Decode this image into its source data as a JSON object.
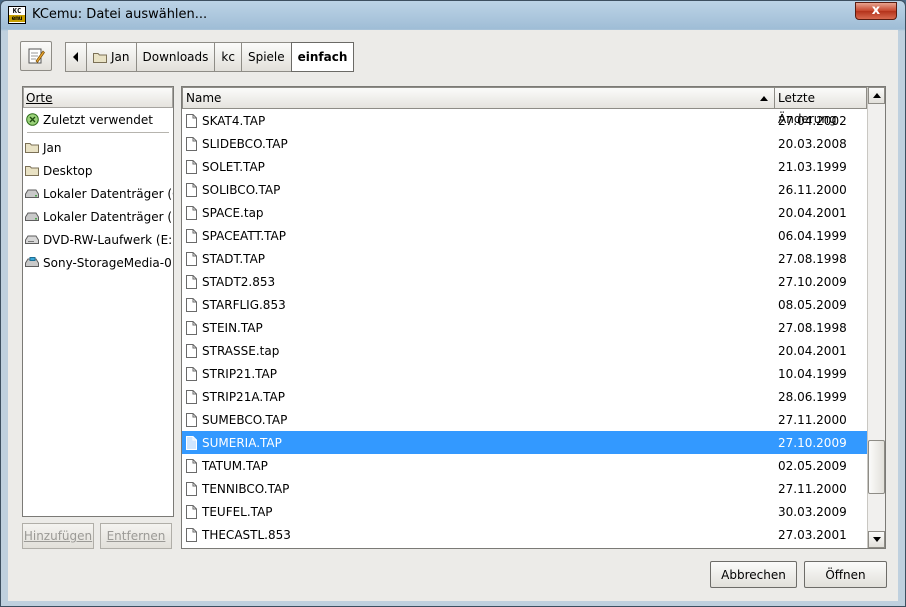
{
  "window": {
    "title": "KCemu: Datei auswählen...",
    "close_label": "x",
    "logo_top": "KC",
    "logo_bottom": "emu"
  },
  "path_bar": {
    "segments": [
      {
        "label": "Jan",
        "icon": "folder-icon"
      },
      {
        "label": "Downloads"
      },
      {
        "label": "kc"
      },
      {
        "label": "Spiele"
      },
      {
        "label": "einfach",
        "active": true
      }
    ]
  },
  "places": {
    "header": "Orte",
    "items": [
      {
        "label": "Zuletzt verwendet",
        "icon": "recent-icon"
      },
      {
        "label": "Jan",
        "icon": "folder-icon"
      },
      {
        "label": "Desktop",
        "icon": "folder-icon"
      },
      {
        "label": "Lokaler Datenträger (C:)",
        "icon": "drive-icon"
      },
      {
        "label": "Lokaler Datenträger (D:)",
        "icon": "drive-icon"
      },
      {
        "label": "DVD-RW-Laufwerk (E:...",
        "icon": "optical-drive-icon"
      },
      {
        "label": "Sony-StorageMedia-0...",
        "icon": "usb-drive-icon"
      }
    ],
    "add_label": "Hinzufügen",
    "remove_label": "Entfernen"
  },
  "files": {
    "columns": {
      "name": "Name",
      "modified": "Letzte Änderung"
    },
    "rows": [
      {
        "name": "SKAT4.TAP",
        "date": "27.04.2002"
      },
      {
        "name": "SLIDEBCO.TAP",
        "date": "20.03.2008"
      },
      {
        "name": "SOLET.TAP",
        "date": "21.03.1999"
      },
      {
        "name": "SOLIBCO.TAP",
        "date": "26.11.2000"
      },
      {
        "name": "SPACE.tap",
        "date": "20.04.2001"
      },
      {
        "name": "SPACEATT.TAP",
        "date": "06.04.1999"
      },
      {
        "name": "STADT.TAP",
        "date": "27.08.1998"
      },
      {
        "name": "STADT2.853",
        "date": "27.10.2009"
      },
      {
        "name": "STARFLIG.853",
        "date": "08.05.2009"
      },
      {
        "name": "STEIN.TAP",
        "date": "27.08.1998"
      },
      {
        "name": "STRASSE.tap",
        "date": "20.04.2001"
      },
      {
        "name": "STRIP21.TAP",
        "date": "10.04.1999"
      },
      {
        "name": "STRIP21A.TAP",
        "date": "28.06.1999"
      },
      {
        "name": "SUMEBCO.TAP",
        "date": "27.11.2000"
      },
      {
        "name": "SUMERIA.TAP",
        "date": "27.10.2009",
        "selected": true
      },
      {
        "name": "TATUM.TAP",
        "date": "02.05.2009"
      },
      {
        "name": "TENNIBCO.TAP",
        "date": "27.11.2000"
      },
      {
        "name": "TEUFEL.TAP",
        "date": "30.03.2009"
      },
      {
        "name": "THECASTL.853",
        "date": "27.03.2001"
      }
    ]
  },
  "buttons": {
    "cancel": "Abbrechen",
    "open": "Öffnen"
  },
  "colors": {
    "selection": "#3399ff",
    "close": "#c6452c"
  }
}
